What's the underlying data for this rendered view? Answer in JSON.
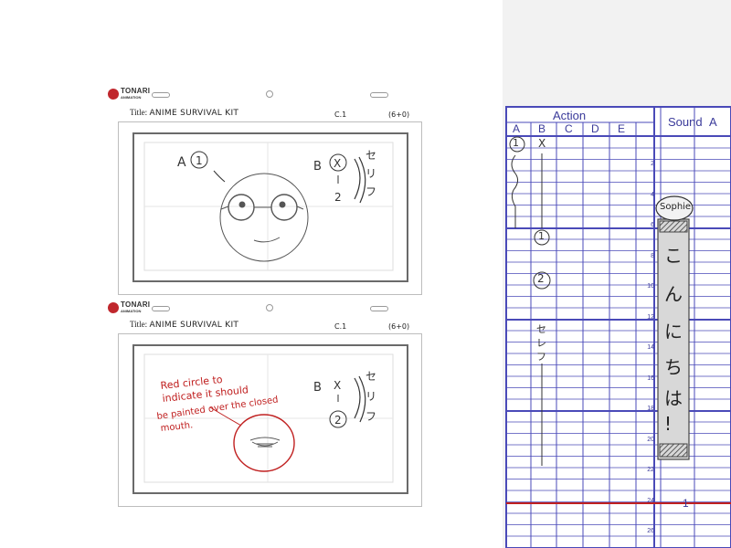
{
  "storyboard": {
    "logo": {
      "brand": "TONARI",
      "sub": "ANIMATION"
    },
    "panels": [
      {
        "title_label": "Title:",
        "title_value": "ANIME SURVIVAL KIT",
        "cut": "C.1",
        "duration": "(6+0)",
        "marks": {
          "left_label": "A",
          "left_circle": "1",
          "right_label": "B",
          "right_x": "X",
          "right_seq": [
            "1",
            "2"
          ],
          "kana": "セリフ"
        }
      },
      {
        "title_label": "Title:",
        "title_value": "ANIME SURVIVAL KIT",
        "cut": "C.1",
        "duration": "(6+0)",
        "marks": {
          "right_label": "B",
          "right_x": "X",
          "right_seq": [
            "1",
            "2"
          ],
          "kana": "セリフ"
        },
        "note": [
          "Red circle to",
          "indicate it should",
          "be painted over the closed",
          "mouth."
        ]
      }
    ]
  },
  "xsheet": {
    "headers": {
      "action": "Action",
      "sound": "Sound",
      "cut_col": "A"
    },
    "columns": [
      "A",
      "B",
      "C",
      "D",
      "E"
    ],
    "frame_numbers": [
      "2",
      "4",
      "6",
      "8",
      "10",
      "12",
      "14",
      "16",
      "18",
      "20",
      "22",
      "24",
      "26"
    ],
    "col_a_entries": [
      "1"
    ],
    "col_b_entries": [
      "X",
      "1",
      "2",
      "セ",
      "レ",
      "フ"
    ],
    "dialogue": {
      "speaker": "Sophie",
      "text": [
        "こ",
        "ん",
        "に",
        "ち",
        "は",
        "!"
      ]
    },
    "marker_number": "1",
    "colors": {
      "grid": "#4a4ab8",
      "red": "#c02020",
      "accent": "#3a3a9a"
    }
  }
}
